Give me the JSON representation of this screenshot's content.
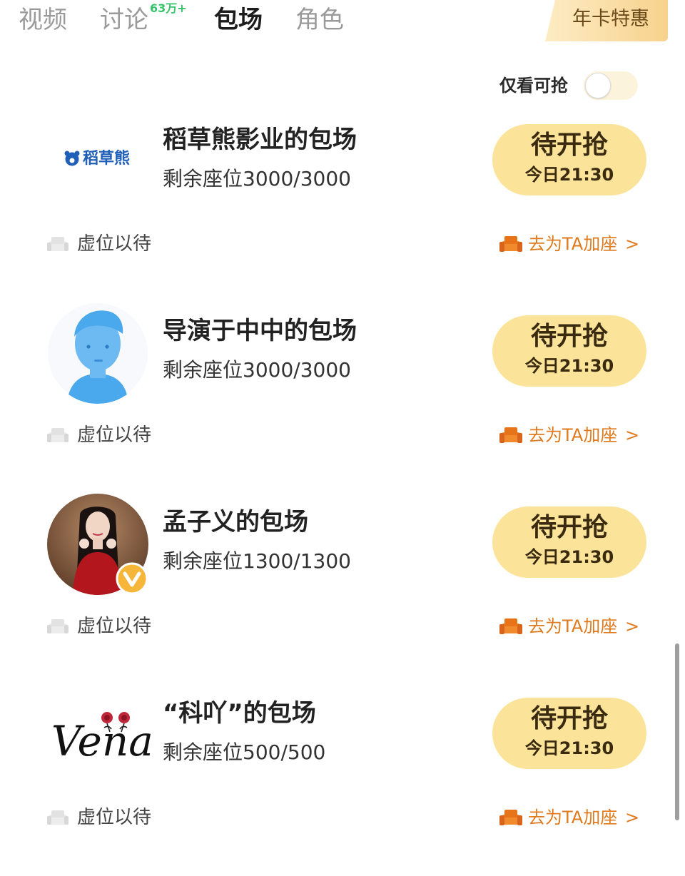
{
  "tabs": [
    {
      "label": "视频",
      "active": false
    },
    {
      "label": "讨论",
      "active": false,
      "badge": "63万+"
    },
    {
      "label": "包场",
      "active": true
    },
    {
      "label": "角色",
      "active": false
    }
  ],
  "annual_card": {
    "label": "年卡特惠"
  },
  "filter": {
    "label": "仅看可抢",
    "enabled": false
  },
  "items": [
    {
      "title": "稻草熊影业的包场",
      "seats": "剩余座位3000/3000",
      "logo_text": "稻草熊",
      "button": {
        "main": "待开抢",
        "time": "今日21:30"
      },
      "wait": "虚位以待",
      "add_seat": "去为TA加座",
      "chevron": ">"
    },
    {
      "title": "导演于中中的包场",
      "seats": "剩余座位3000/3000",
      "button": {
        "main": "待开抢",
        "time": "今日21:30"
      },
      "wait": "虚位以待",
      "add_seat": "去为TA加座",
      "chevron": ">"
    },
    {
      "title": "孟子义的包场",
      "seats": "剩余座位1300/1300",
      "verified_badge": "V",
      "button": {
        "main": "待开抢",
        "time": "今日21:30"
      },
      "wait": "虚位以待",
      "add_seat": "去为TA加座",
      "chevron": ">"
    },
    {
      "title": "“科吖”的包场",
      "seats": "剩余座位500/500",
      "logo_text": "Vena",
      "button": {
        "main": "待开抢",
        "time": "今日21:30"
      },
      "wait": "虚位以待",
      "add_seat": "去为TA加座",
      "chevron": ">"
    }
  ],
  "colors": {
    "button_bg": "#fbe49a",
    "accent_orange": "#e07a1e",
    "badge_green": "#35c46a",
    "logo_blue": "#1f5fb8"
  },
  "icons": [
    "sofa-icon",
    "sofa-orange-icon",
    "bear-logo-icon",
    "verified-icon"
  ]
}
